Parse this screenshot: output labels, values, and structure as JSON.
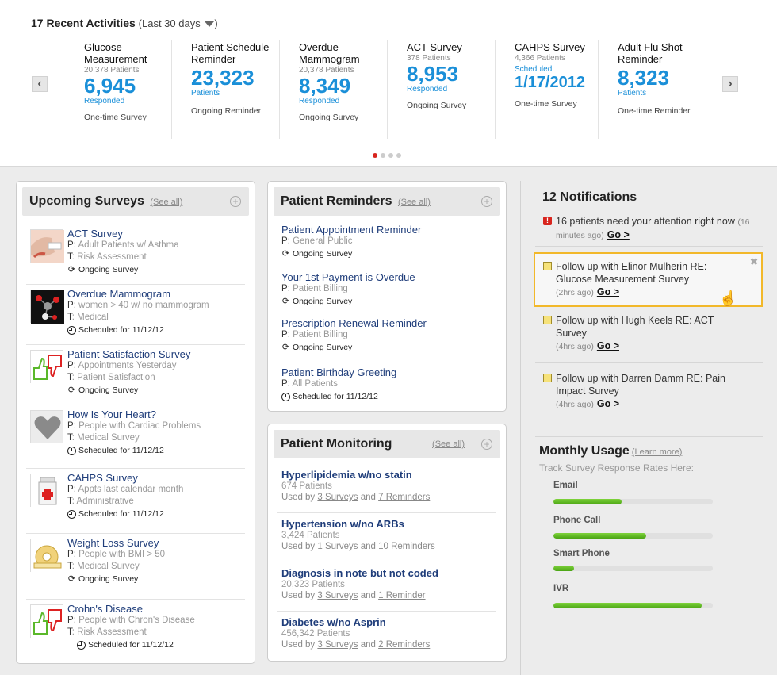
{
  "recent": {
    "title": "17 Recent Activities",
    "subtitle": "(Last 30 days",
    "subtitle_end": ")",
    "items": [
      {
        "name": "Glucose Measurement",
        "patients": "20,378 Patients",
        "number": "6,945",
        "number_label": "Responded",
        "type": "One-time Survey"
      },
      {
        "name": "Patient Schedule Reminder",
        "patients": "",
        "number": "23,323",
        "number_label": "Patients",
        "type": "Ongoing Reminder"
      },
      {
        "name": "Overdue Mammogram",
        "patients": "20,378 Patients",
        "number": "8,349",
        "number_label": "Responded",
        "type": "Ongoing Survey"
      },
      {
        "name": "ACT Survey",
        "patients": "378 Patients",
        "number": "8,953",
        "number_label": "Responded",
        "type": "Ongoing Survey"
      },
      {
        "name": "CAHPS Survey",
        "patients": "4,366 Patients",
        "number_label_top": "Scheduled",
        "number": "1/17/2012",
        "number_label": "",
        "type": "One-time Survey"
      },
      {
        "name": "Adult Flu Shot Reminder",
        "patients": "",
        "number": "8,323",
        "number_label": "Patients",
        "type": "One-time Reminder"
      }
    ]
  },
  "upcoming": {
    "title": "Upcoming Surveys",
    "see_all": "(See all)",
    "items": [
      {
        "name": "ACT Survey",
        "p": "Adult Patients w/ Asthma",
        "t": "Risk Assessment",
        "status": "Ongoing Survey",
        "status_icon": "refresh",
        "thumb": "asthma-inhaler"
      },
      {
        "name": "Overdue Mammogram",
        "p": "women > 40 w/ no mammogram",
        "t": "Medical",
        "status": "Scheduled for 11/12/12",
        "status_icon": "clock",
        "thumb": "molecule"
      },
      {
        "name": "Patient Satisfaction Survey",
        "p": "Appointments Yesterday",
        "t": "Patient Satisfaction",
        "status": "Ongoing Survey",
        "status_icon": "refresh",
        "thumb": "thumbs"
      },
      {
        "name": "How Is Your Heart?",
        "p": "People with Cardiac Problems",
        "t": "Medical Survey",
        "status": "Scheduled for 11/12/12",
        "status_icon": "clock",
        "thumb": "heart"
      },
      {
        "name": "CAHPS Survey",
        "p": "Appts last calendar month",
        "t": "Administrative",
        "status": "Scheduled for 11/12/12",
        "status_icon": "clock",
        "thumb": "pill-bottle"
      },
      {
        "name": "Weight Loss Survey",
        "p": "People with BMI > 50",
        "t": "Medical Survey",
        "status": "Ongoing Survey",
        "status_icon": "refresh",
        "thumb": "tape-measure"
      },
      {
        "name": "Crohn's Disease",
        "p": "People with Chron's Disease",
        "t": "Risk Assessment",
        "status": "Scheduled for 11/12/12",
        "status_icon": "clock",
        "thumb": "thumbs"
      }
    ]
  },
  "reminders": {
    "title": "Patient Reminders",
    "see_all": "(See all)",
    "items": [
      {
        "name": "Patient Appointment Reminder",
        "p": "General Public",
        "status": "Ongoing Survey",
        "status_icon": "refresh"
      },
      {
        "name": "Your 1st Payment is Overdue",
        "p": "Patient Billing",
        "status": "Ongoing Survey",
        "status_icon": "refresh"
      },
      {
        "name": "Prescription Renewal Reminder",
        "p": "Patient Billing",
        "status": "Ongoing Survey",
        "status_icon": "refresh"
      },
      {
        "name": "Patient Birthday Greeting",
        "p": "All Patients",
        "status": "Scheduled for 11/12/12",
        "status_icon": "clock"
      }
    ]
  },
  "monitoring": {
    "title": "Patient Monitoring",
    "see_all": "(See all)",
    "used_by": "Used by",
    "and": "and",
    "items": [
      {
        "name": "Hyperlipidemia w/no statin",
        "patients": "674 Patients",
        "surveys": "3 Surveys",
        "reminders": "7 Reminders"
      },
      {
        "name": "Hypertension w/no ARBs",
        "patients": "3,424 Patients",
        "surveys": "1 Surveys",
        "reminders": "10 Reminders"
      },
      {
        "name": "Diagnosis in note but not coded",
        "patients": "20,323 Patients",
        "surveys": "3 Surveys",
        "reminders": "1 Reminder"
      },
      {
        "name": "Diabetes w/no Asprin",
        "patients": "456,342 Patients",
        "surveys": "3 Surveys",
        "reminders": "2 Reminders"
      }
    ]
  },
  "notifications": {
    "title": "12 Notifications",
    "go": "Go >",
    "items": [
      {
        "text": "16 patients need your attention right now",
        "time": "(16 minutes ago)",
        "icon": "alert"
      },
      {
        "text": "Follow up with Elinor Mulherin RE: Glucose Measurement Survey",
        "time": "(2hrs ago)",
        "icon": "note"
      },
      {
        "text": "Follow up with Hugh Keels RE: ACT Survey",
        "time": "(4hrs ago)",
        "icon": "note"
      },
      {
        "text": "Follow up with Darren Damm RE: Pain Impact Survey",
        "time": "(4hrs ago)",
        "icon": "note"
      }
    ]
  },
  "usage": {
    "title": "Monthly Usage",
    "learn_more": "(Learn more)",
    "subtitle": "Track Survey Response Rates Here:",
    "bars": [
      {
        "label": "Email",
        "fraction": 0.43
      },
      {
        "label": "Phone Call",
        "fraction": 0.58
      },
      {
        "label": "Smart Phone",
        "fraction": 0.13
      },
      {
        "label": "IVR",
        "fraction": 0.93
      }
    ]
  },
  "colors": {
    "accent": "#1a8fd8",
    "link": "#1f3d7a",
    "highlight": "#f2b82a",
    "bar": "#5cb521"
  }
}
